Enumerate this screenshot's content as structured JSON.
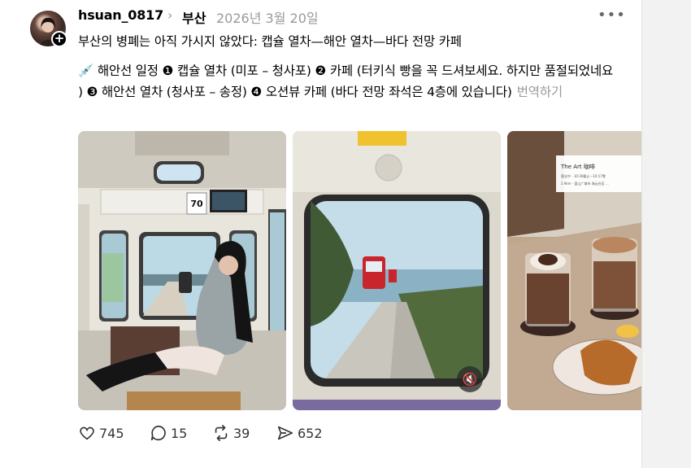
{
  "post": {
    "username": "hsuan_0817",
    "topic": "부산",
    "date": "2026년 3월 20일",
    "line1": "부산의 병폐는 아직 가시지 않았다: 캡슐 열차—해안 열차—바다 전망 카페",
    "body": "💉 해안선 일정 ❶ 캡슐 열차 (미포 – 청사포) ❷ 카페 (터키식 빵을 꼭 드셔보세요. 하지만 품절되었네요 ) ❸ 해안선 열차 (청사포 – 송정) ❹ 오션뷰 카페 (바다 전망 좌석은 4층에 있습니다)",
    "translate_label": "번역하기",
    "images": [
      {
        "name": "photo-capsule-train-interior",
        "caption_sign": "70"
      },
      {
        "name": "photo-coastal-train-view"
      },
      {
        "name": "photo-cafe-drinks",
        "menu_title": "The Art 咖啡",
        "menu_lines": [
          "营业中 · 10:30截止—10:17零",
          "2.9km · 釜山广域市 海云台区 ..."
        ]
      }
    ],
    "actions": {
      "likes": "745",
      "comments": "15",
      "reposts": "39",
      "shares": "652"
    }
  },
  "colors": {
    "muted_text": "#999999",
    "action_icon": "#333333",
    "background": "#ffffff",
    "side_panel": "#f2f2f2"
  }
}
